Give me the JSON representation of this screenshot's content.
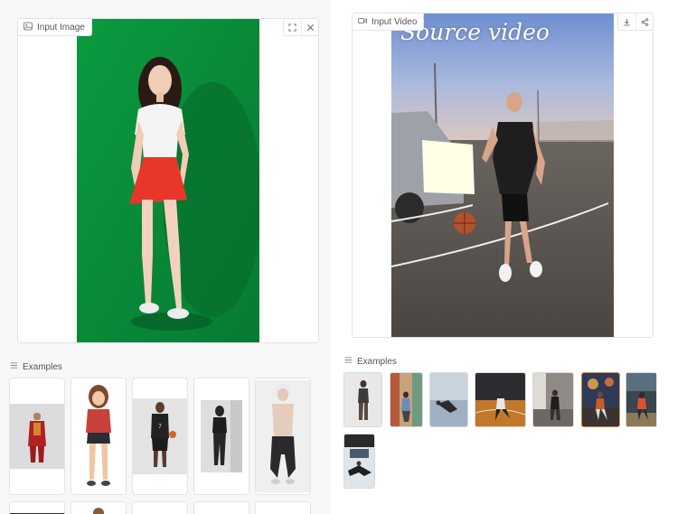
{
  "input_image": {
    "label": "Input Image",
    "icon": "image-icon",
    "buttons": [
      "fullscreen-icon",
      "close-icon"
    ],
    "colors": {
      "backdrop": "#0a8c3a",
      "skirt": "#e8362a",
      "top": "#f5f5f5"
    }
  },
  "source_video": {
    "label": "Input Video",
    "overlay_text": "Source video",
    "icon": "video-icon",
    "buttons": [
      "download-icon",
      "share-icon"
    ]
  },
  "left_examples": {
    "label": "Examples",
    "items": [
      "joker-red-suit",
      "anime-girl-red-top",
      "basketball-player",
      "woman-black-outfit",
      "figure-white-hair",
      "partial-1",
      "partial-2",
      "partial-3",
      "partial-4",
      "partial-5"
    ]
  },
  "right_examples": {
    "label": "Examples",
    "items": [
      "woman-dancing",
      "street-dancer",
      "floor-breakdancer",
      "court-dancer",
      "gym-dancer",
      "kid-fireworks",
      "arcade-dancer",
      "snow-breakdancer"
    ]
  }
}
